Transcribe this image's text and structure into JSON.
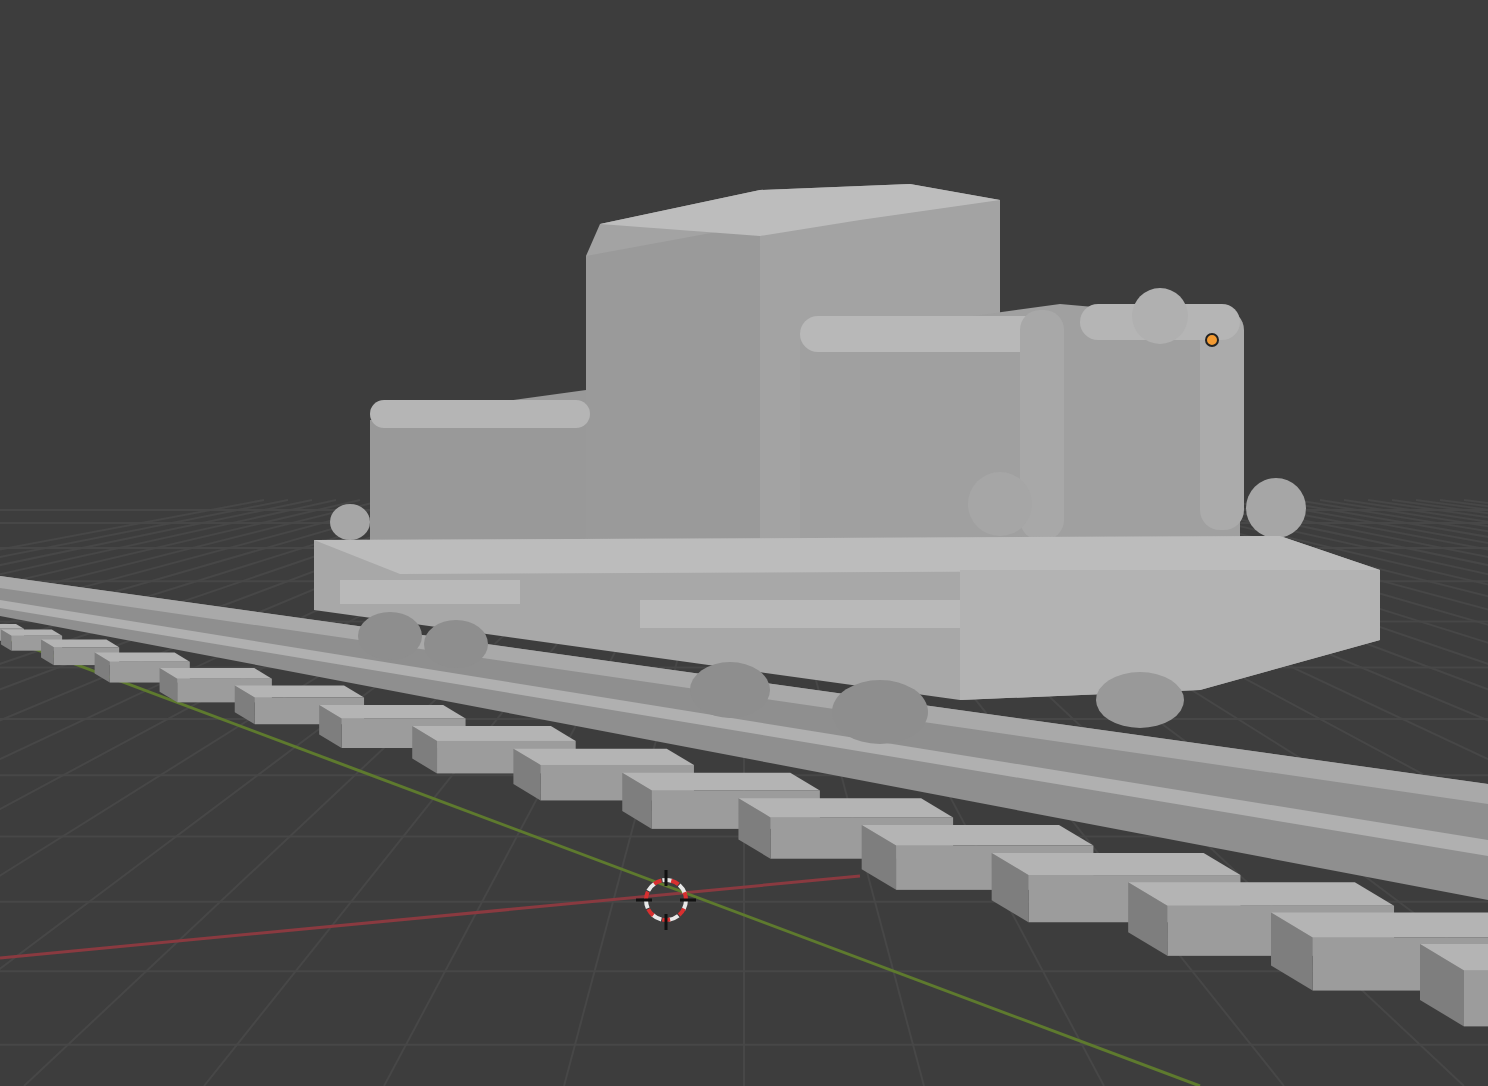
{
  "viewport": {
    "kind": "scene"
  }
}
